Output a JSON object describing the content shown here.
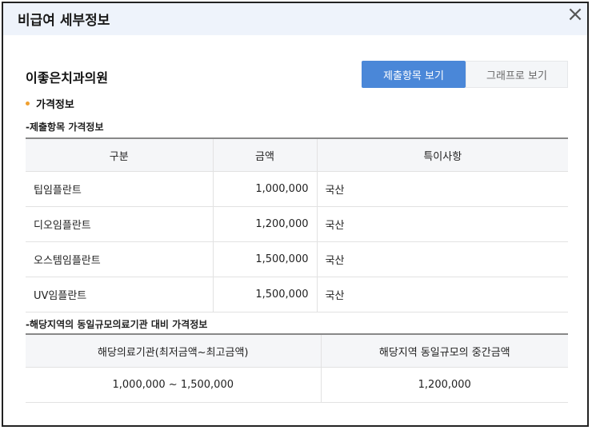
{
  "dialog": {
    "title": "비급여 세부정보",
    "close_icon": "close-icon"
  },
  "clinic": {
    "name": "이좋은치과의원"
  },
  "view_buttons": {
    "items": "제출항목 보기",
    "graph": "그래프로 보기"
  },
  "section": {
    "title": "가격정보"
  },
  "submitted": {
    "subtitle": "-제출항목 가격정보",
    "headers": {
      "category": "구분",
      "amount": "금액",
      "notes": "특이사항"
    },
    "rows": [
      {
        "name": "팁임플란트",
        "amount": "1,000,000",
        "note": "국산"
      },
      {
        "name": "디오임플란트",
        "amount": "1,200,000",
        "note": "국산"
      },
      {
        "name": "오스템임플란트",
        "amount": "1,500,000",
        "note": "국산"
      },
      {
        "name": "UV임플란트",
        "amount": "1,500,000",
        "note": "국산"
      }
    ]
  },
  "regional": {
    "subtitle": "-해당지역의 동일규모의료기관 대비 가격정보",
    "headers": {
      "range": "해당의료기관(최저금액~최고금액)",
      "median": "해당지역 동일규모의 중간금액"
    },
    "row": {
      "range": "1,000,000 ~ 1,500,000",
      "median": "1,200,000"
    }
  },
  "colors": {
    "primary": "#4a87d8",
    "header_bg": "#eef3fb",
    "bullet": "#f0a030"
  }
}
